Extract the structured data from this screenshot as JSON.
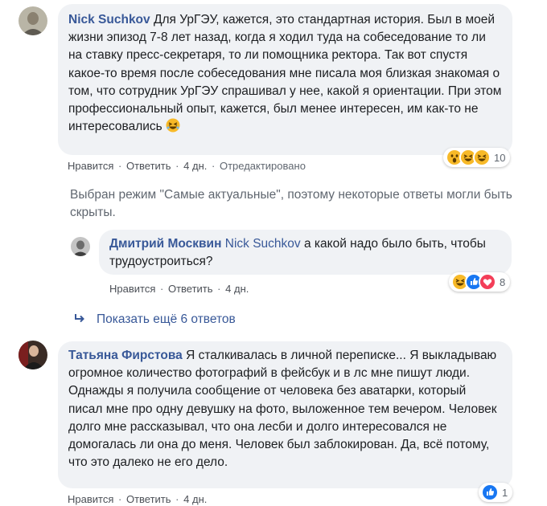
{
  "comments": [
    {
      "author": "Nick Suchkov",
      "text": "Для УрГЭУ, кажется, это стандартная история. Был в моей жизни эпизод 7-8 лет назад, когда я ходил туда на собеседование то ли на ставку пресс-секретаря, то ли помощника ректора. Так вот спустя какое-то время после собеседования мне писала моя близкая знакомая о том, что сотрудник УрГЭУ спрашивал у нее, какой я ориентации. При этом профессиональный опыт, кажется, был менее интересен, им как-то не интересовались",
      "like_label": "Нравится",
      "reply_label": "Ответить",
      "time": "4 дн.",
      "edited": "Отредактировано",
      "reactions": [
        "wow-icon",
        "laugh-icon",
        "laugh-icon"
      ],
      "reaction_count": "10"
    },
    {
      "author": "Дмитрий Москвин",
      "mention": "Nick Suchkov",
      "text": "а какой надо было быть, чтобы трудоустроиться?",
      "like_label": "Нравится",
      "reply_label": "Ответить",
      "time": "4 дн.",
      "reactions": [
        "laugh-icon",
        "like-icon",
        "love-icon"
      ],
      "reaction_count": "8"
    },
    {
      "author": "Татьяна Фирстова",
      "text": "Я сталкивалась в личной переписке... Я выкладываю огромное количество фотографий в фейсбук и в лс мне пишут люди. Однажды я получила сообщение от человека без аватарки, который писал мне про одну девушку на фото, выложенное тем вечером. Человек долго мне рассказывал, что она лесби и долго интересовался не домогалась ли она до меня. Человек был заблокирован. Да, всё потому, что это далеко не его дело.",
      "like_label": "Нравится",
      "reply_label": "Ответить",
      "time": "4 дн.",
      "reactions": [
        "like-icon"
      ],
      "reaction_count": "1"
    }
  ],
  "notice": "Выбран режим \"Самые актуальные\", поэтому некоторые ответы могли быть скрыты.",
  "show_more": "Показать ещё 6 ответов",
  "separator": "·",
  "colors": {
    "link": "#385898",
    "bubble": "#f0f2f5",
    "meta": "#606770",
    "like": "#1877f2",
    "love": "#f33e58",
    "haha": "#f7b928"
  }
}
